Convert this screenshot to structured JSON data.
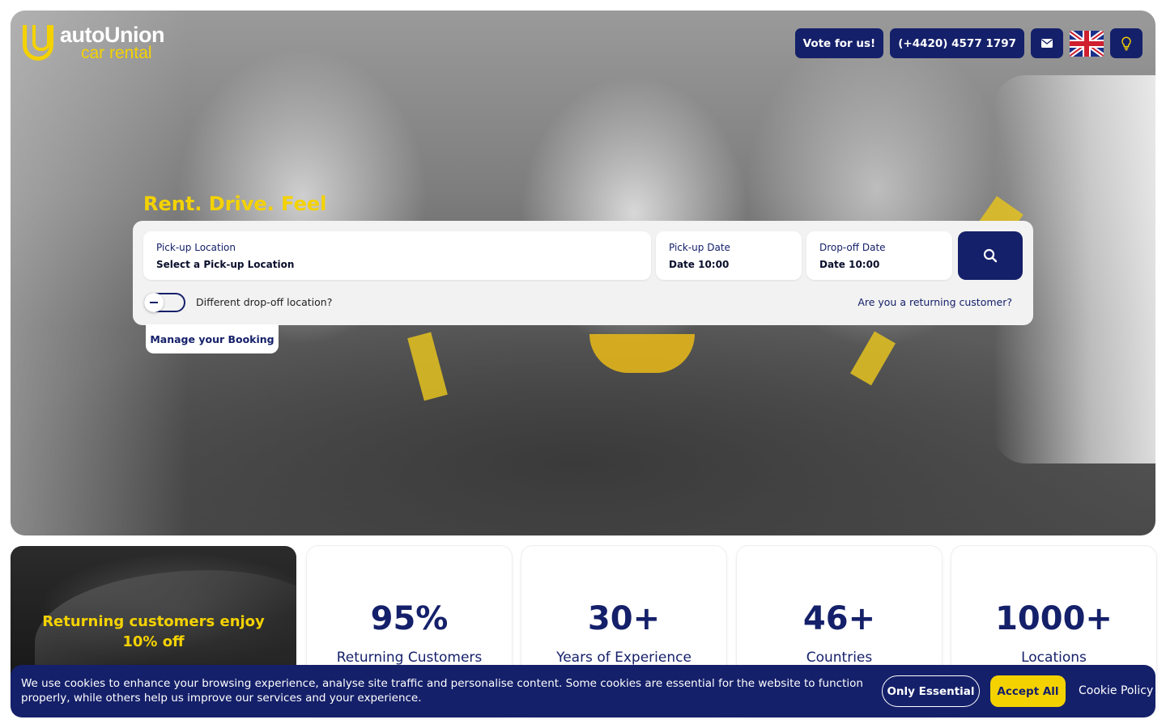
{
  "brand": {
    "name": "autoUnion",
    "sub": "car rental",
    "accent": "#f4d200",
    "navy": "#15206a"
  },
  "topbar": {
    "vote_label": "Vote for us!",
    "phone_label": "(+4420) 4577 1797",
    "mail_icon": "mail-icon",
    "language_icon": "uk-flag-icon",
    "theme_icon": "lightbulb-icon"
  },
  "hero": {
    "tagline": "Rent. Drive. Feel"
  },
  "search": {
    "pickup_location": {
      "label": "Pick-up Location",
      "value": "Select a Pick-up Location"
    },
    "pickup_date": {
      "label": "Pick-up Date",
      "value": "Date 10:00"
    },
    "dropoff_date": {
      "label": "Drop-off Date",
      "value": "Date 10:00"
    },
    "search_icon": "search-icon",
    "toggle_label": "Different drop-off location?",
    "returning_link": "Are you a returning customer?",
    "manage_label": "Manage your Booking"
  },
  "promo": {
    "line1": "Returning customers enjoy",
    "line2": "10% off"
  },
  "stats": [
    {
      "value": "95%",
      "caption": "Returning Customers"
    },
    {
      "value": "30+",
      "caption": "Years of Experience"
    },
    {
      "value": "46+",
      "caption": "Countries"
    },
    {
      "value": "1000+",
      "caption": "Locations"
    }
  ],
  "cookie": {
    "text": "We use cookies to enhance your browsing experience, analyse site traffic and personalise content. Some cookies are essential for the website to function properly, while others help us improve our services and your experience.",
    "essential_label": "Only Essential",
    "accept_label": "Accept All",
    "policy_label": "Cookie Policy"
  }
}
